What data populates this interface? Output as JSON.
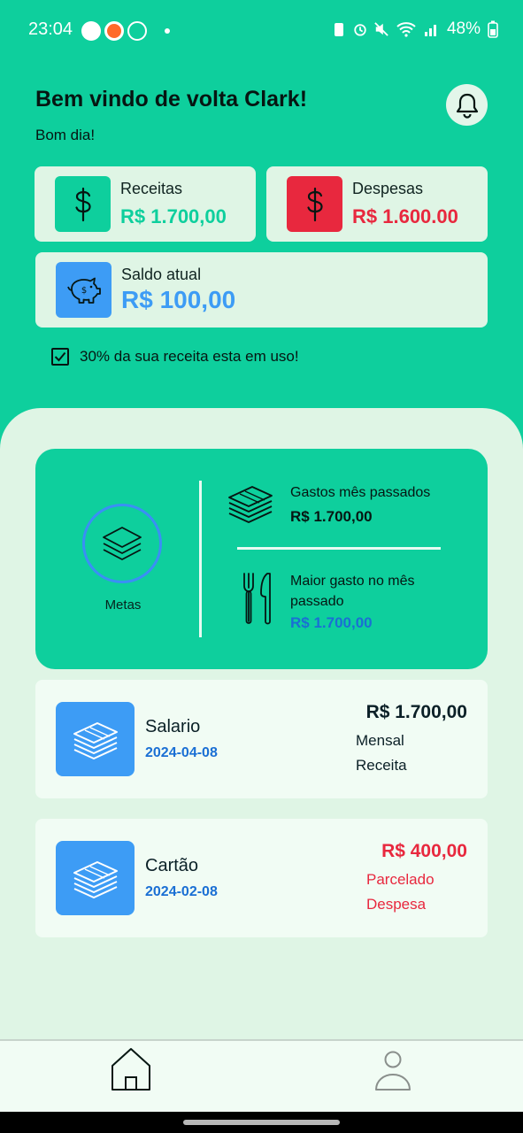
{
  "status_bar": {
    "time": "23:04",
    "battery": "48%"
  },
  "header": {
    "greeting": "Bem vindo de volta Clark!",
    "subgreeting": "Bom dia!"
  },
  "cards": {
    "income": {
      "label": "Receitas",
      "value": "R$ 1.700,00",
      "icon": "dollar-icon",
      "color": "#0ecf9d"
    },
    "expense": {
      "label": "Despesas",
      "value": "R$ 1.600.00",
      "icon": "dollar-icon",
      "color": "#e8283e"
    },
    "balance": {
      "label": "Saldo atual",
      "value": "R$ 100,00",
      "icon": "piggy-bank-icon",
      "color": "#3d9cf5"
    }
  },
  "usage_notice": "30% da sua receita esta em uso!",
  "summary": {
    "goals_label": "Metas",
    "last_month_spending_label": "Gastos mês passados",
    "last_month_spending_value": "R$ 1.700,00",
    "biggest_expense_label": "Maior gasto no mês passado",
    "biggest_expense_value": "R$ 1.700,00"
  },
  "transactions": [
    {
      "name": "Salario",
      "date": "2024-04-08",
      "amount": "R$ 1.700,00",
      "frequency": "Mensal",
      "type": "Receita",
      "color": "#0b2027"
    },
    {
      "name": "Cartão",
      "date": "2024-02-08",
      "amount": "R$ 400,00",
      "frequency": "Parcelado",
      "type": "Despesa",
      "color": "#e8283e"
    }
  ],
  "nav": {
    "items": [
      {
        "icon": "home-icon"
      },
      {
        "icon": "user-icon"
      }
    ]
  }
}
